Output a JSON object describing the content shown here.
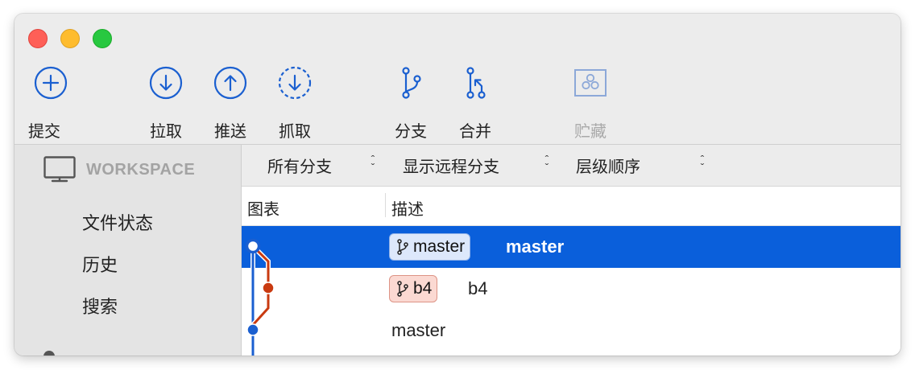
{
  "window": {
    "traffic_lights": [
      "close",
      "minimize",
      "zoom"
    ]
  },
  "toolbar": {
    "commit": "提交",
    "pull": "拉取",
    "push": "推送",
    "fetch": "抓取",
    "branch": "分支",
    "merge": "合并",
    "stash": "贮藏",
    "accent_color": "#1a5fd0",
    "disabled_color": "#a9a9a9"
  },
  "sidebar": {
    "section": "WORKSPACE",
    "items": [
      {
        "label": "文件状态"
      },
      {
        "label": "历史"
      },
      {
        "label": "搜索"
      }
    ]
  },
  "filters": {
    "branches": "所有分支",
    "remote": "显示远程分支",
    "order": "层级顺序"
  },
  "columns": {
    "graph": "图表",
    "description": "描述"
  },
  "commits": [
    {
      "tag": "master",
      "description": "master",
      "selected": true,
      "tag_color": "#dde8fb"
    },
    {
      "tag": "b4",
      "description": "b4",
      "selected": false,
      "tag_color": "#fbd9d2"
    },
    {
      "tag": "",
      "description": "master",
      "selected": false
    }
  ],
  "colors": {
    "selection": "#0a5fdb",
    "lane_blue": "#1a5fd0",
    "lane_red": "#c93a10"
  }
}
